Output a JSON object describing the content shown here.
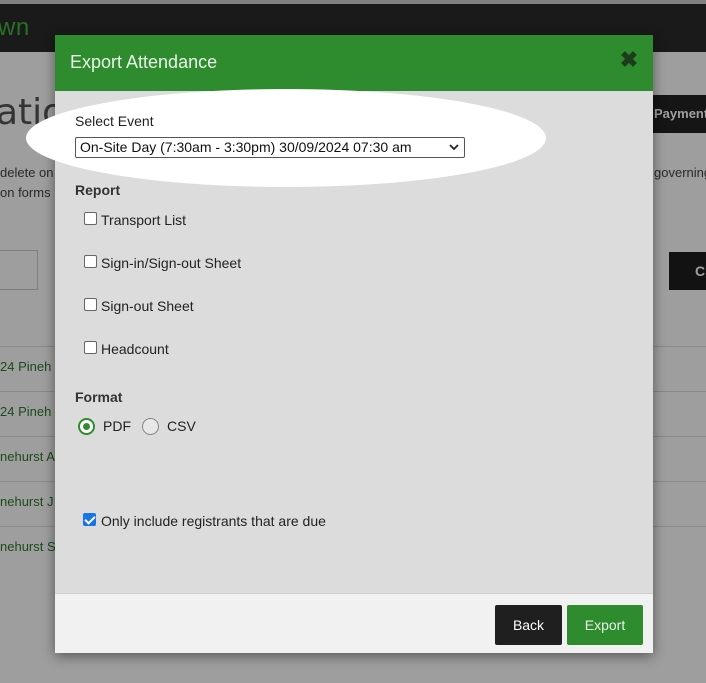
{
  "background": {
    "logo_text": "wn",
    "page_title_fragment": "atio",
    "payment_tab": "Payment",
    "line1_fragment": "delete on",
    "line2_fragment": "on forms",
    "right_fragment": "governing",
    "dark_button_fragment": "C",
    "rows": [
      "24 Pineh",
      "24 Pineh",
      "nehurst A",
      "nehurst J",
      "nehurst S"
    ]
  },
  "modal": {
    "title": "Export Attendance",
    "close_glyph": "✖",
    "select_event_label": "Select Event",
    "select_event_value": "On-Site Day (7:30am - 3:30pm) 30/09/2024 07:30 am",
    "report_label": "Report",
    "report_options": [
      {
        "label": "Transport List",
        "checked": false
      },
      {
        "label": "Sign-in/Sign-out Sheet",
        "checked": false
      },
      {
        "label": "Sign-out Sheet",
        "checked": false
      },
      {
        "label": "Headcount",
        "checked": false
      }
    ],
    "format_label": "Format",
    "format_options": [
      {
        "label": "PDF",
        "selected": true
      },
      {
        "label": "CSV",
        "selected": false
      }
    ],
    "due_only_label": "Only include registrants that are due",
    "due_only_checked": true,
    "back_button": "Back",
    "export_button": "Export"
  },
  "colors": {
    "brand_green": "#2e8b2e",
    "dark": "#1f1f1f",
    "checkbox_blue": "#1a73e8"
  }
}
